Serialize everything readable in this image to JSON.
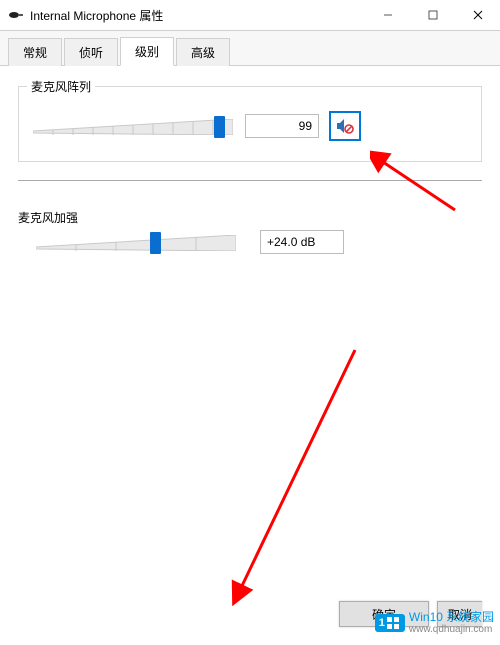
{
  "window": {
    "title": "Internal Microphone 属性"
  },
  "tabs": {
    "t0": "常规",
    "t1": "侦听",
    "t2": "级别",
    "t3": "高级",
    "active_index": 2
  },
  "mic_array": {
    "label": "麦克风阵列",
    "value": "99",
    "slider_percent": 95,
    "muted": true
  },
  "mic_boost": {
    "label": "麦克风加强",
    "value": "+24.0 dB",
    "slider_percent": 60
  },
  "buttons": {
    "ok": "确定",
    "cancel": "取消"
  },
  "watermark": {
    "badge_prefix": "1",
    "badge_suffix": "Win10",
    "line1": "系统家园",
    "url": "www.qdhuajin.com"
  },
  "chart_data": {
    "type": "slider",
    "sliders": [
      {
        "name": "麦克风阵列",
        "min": 0,
        "max": 100,
        "value": 99,
        "display": "99"
      },
      {
        "name": "麦克风加强",
        "min": 0,
        "max": 40,
        "value": 24,
        "display": "+24.0 dB"
      }
    ]
  }
}
